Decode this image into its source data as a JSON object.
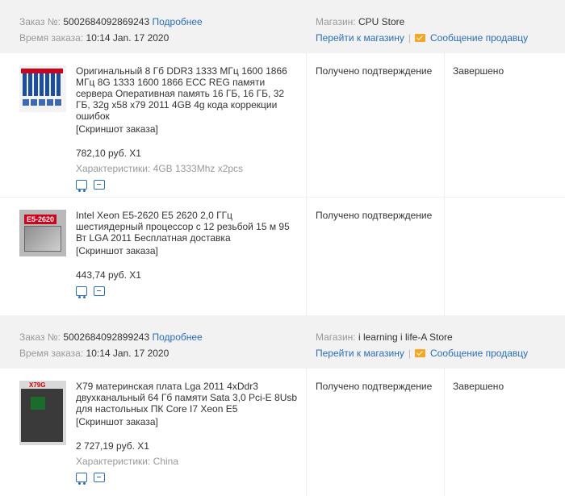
{
  "orders": [
    {
      "order_no_label": "Заказ №:",
      "order_no": "5002684092869243",
      "details_link": "Подробнее",
      "time_label": "Время заказа:",
      "time_value": "10:14 Jan. 17 2020",
      "store_label": "Магазин:",
      "store_name": "CPU Store",
      "go_store": "Перейти к магазину",
      "separator": "|",
      "message_seller": "Сообщение продавцу",
      "order_status": "Завершено",
      "items": [
        {
          "title": "Оригинальный 8 Гб DDR3 1333 МГц 1600 1866 МГц 8G 1333 1600 1866 ECC REG памяти сервера Оперативная память 16 ГБ, 16 ГБ, 32 ГБ, 32g x58 x79 2011 4GB 4g кода коррекции ошибок",
          "screenshot": "[Скриншот заказа]",
          "price": "782,10 руб. X1",
          "attrs_label": "Характеристики:",
          "attrs_value": "4GB 1333Mhz x2pcs",
          "confirm": "Получено подтверждение"
        },
        {
          "title": "Intel Xeon E5-2620 E5 2620 2,0 ГГц шестиядерный процессор с 12 резьбой 15 м 95 Вт LGA 2011 Бесплатная доставка",
          "screenshot": "[Скриншот заказа]",
          "price": "443,74 руб. X1",
          "thumb_label": "E5-2620",
          "confirm": "Получено подтверждение"
        }
      ]
    },
    {
      "order_no_label": "Заказ №:",
      "order_no": "5002684092899243",
      "details_link": "Подробнее",
      "time_label": "Время заказа:",
      "time_value": "10:14 Jan. 17 2020",
      "store_label": "Магазин:",
      "store_name": "i learning i life-A Store",
      "go_store": "Перейти к магазину",
      "separator": "|",
      "message_seller": "Сообщение продавцу",
      "order_status": "Завершено",
      "items": [
        {
          "title": "X79 материнская плата Lga 2011 4xDdr3 двухканальный 64 Гб памяти Sata 3,0 Pci-E 8Usb для настольных ПК Core I7 Xeon E5",
          "screenshot": "[Скриншот заказа]",
          "price": "2 727,19 руб. X1",
          "attrs_label": "Характеристики:",
          "attrs_value": "China",
          "thumb_label": "X79G",
          "confirm": "Получено подтверждение"
        }
      ]
    }
  ],
  "icons": {
    "tracking": "truck-icon",
    "snapshot": "receipt-icon",
    "message": "mail-icon"
  },
  "colors": {
    "link": "#2a6ebb",
    "header_bg": "#f2f2f2",
    "muted": "#999999",
    "mail": "#f5a623"
  }
}
